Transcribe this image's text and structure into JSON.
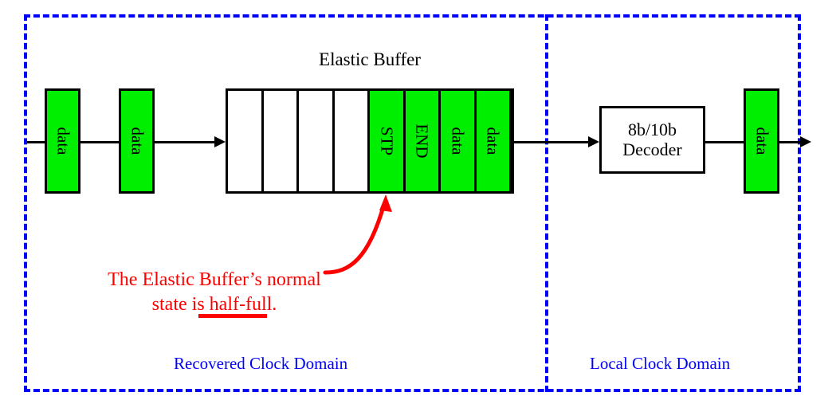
{
  "diagram": {
    "buffer_title": "Elastic Buffer",
    "buffer_cells": [
      {
        "label": "",
        "filled": false
      },
      {
        "label": "",
        "filled": false
      },
      {
        "label": "",
        "filled": false
      },
      {
        "label": "",
        "filled": false
      },
      {
        "label": "STP",
        "filled": true
      },
      {
        "label": "END",
        "filled": true
      },
      {
        "label": "data",
        "filled": true
      },
      {
        "label": "data",
        "filled": true
      }
    ],
    "input_boxes": [
      {
        "label": "data"
      },
      {
        "label": "data"
      }
    ],
    "decoder": {
      "line1": "8b/10b",
      "line2": "Decoder"
    },
    "output_box": {
      "label": "data"
    },
    "annotation": {
      "line1": "The Elastic Buffer’s normal",
      "line2_prefix": "state is ",
      "line2_underlined": "half-full."
    },
    "domains": {
      "left_label": "Recovered Clock Domain",
      "right_label": "Local Clock Domain"
    },
    "colors": {
      "data_fill": "#00ee00",
      "domain_boundary": "#0000ff",
      "annotation": "#ff0000",
      "wire": "#000000"
    }
  }
}
